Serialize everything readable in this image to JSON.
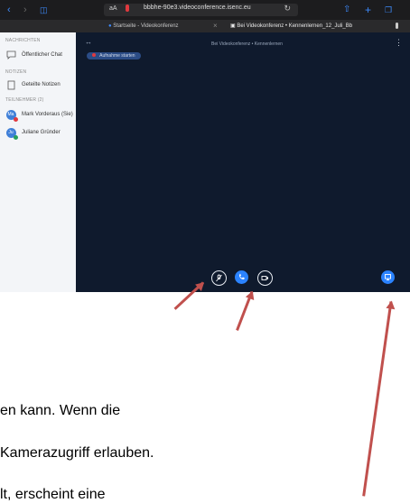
{
  "browser": {
    "url": "bbbhe-90e3.videoconference.isenc.eu",
    "aa_label": "aA",
    "tabs": [
      {
        "label": "Startseite - Videokonferenz"
      },
      {
        "label": "Bei Videokonferenz • Kennenlernen_12_Juli_Bb"
      }
    ]
  },
  "sidebar": {
    "messages_heading": "NACHRICHTEN",
    "public_chat": "Öffentlicher Chat",
    "notes_heading": "NOTIZEN",
    "shared_notes": "Geteilte Notizen",
    "participants_heading": "TEILNEHMER (2)",
    "participants": [
      {
        "initials": "Ma",
        "name": "Mark Vorderaus (Sie)",
        "color": "#3f7fd8",
        "badge": "#e0393e"
      },
      {
        "initials": "Ju",
        "name": "Juliane Gründer",
        "color": "#3f7fd8",
        "badge": "#25a05c"
      }
    ]
  },
  "main": {
    "meeting_title": "Bei Videokonferenz • Kennenlernen",
    "recording_label": "Aufnahme starten",
    "accent": "#2b83ff"
  },
  "annotation": {
    "arrow_color": "#c0504d"
  },
  "text_lines": [
    "en kann. Wenn die",
    "Kamerazugriff erlauben.",
    "lt, erscheint eine"
  ]
}
